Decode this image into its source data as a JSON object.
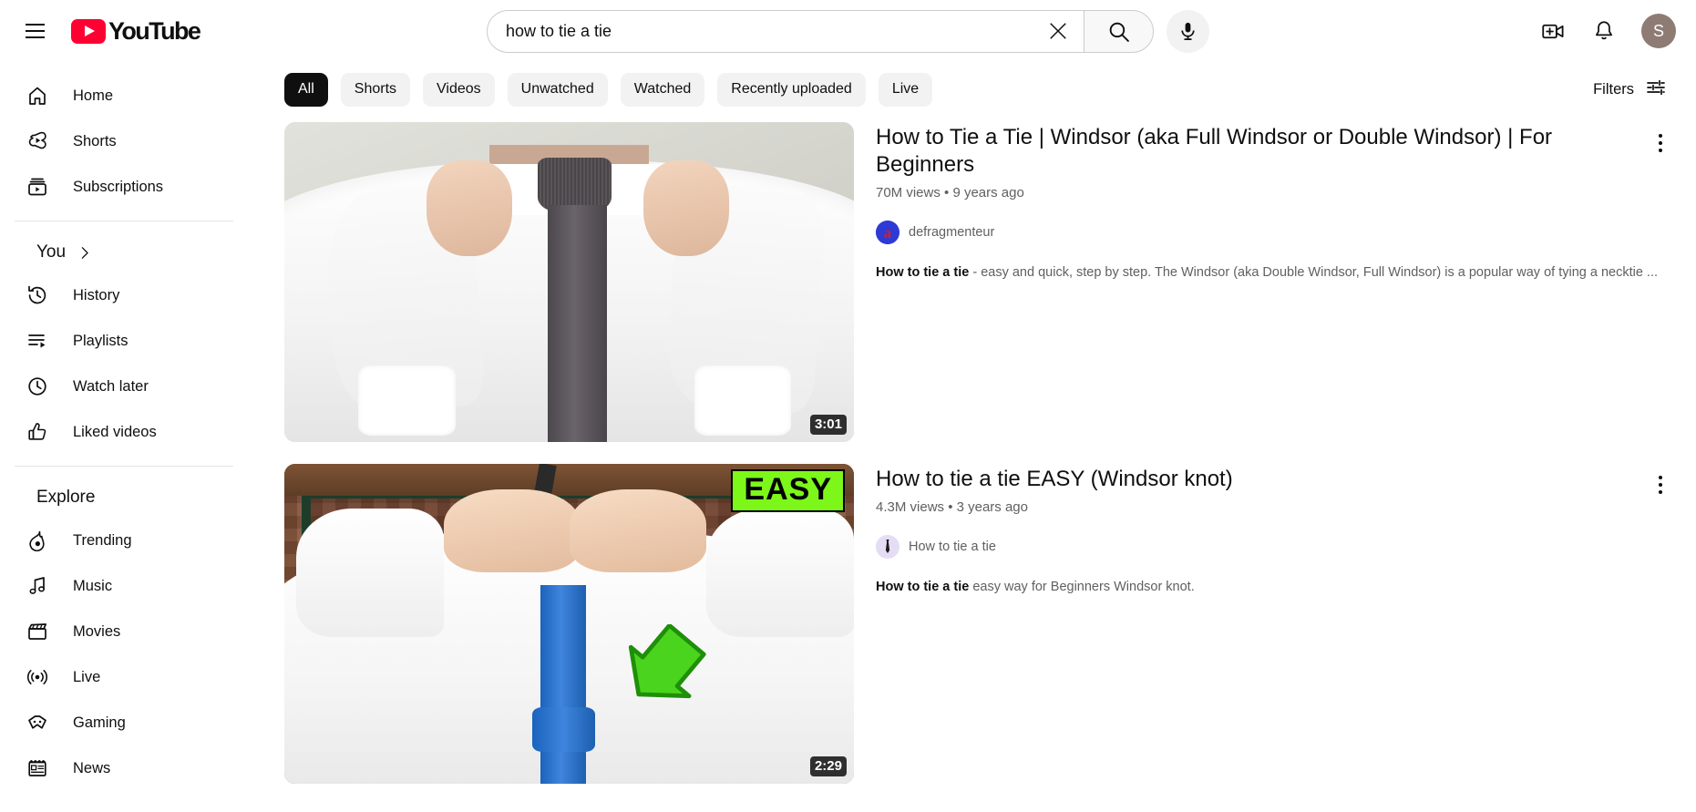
{
  "topbar": {
    "menu_icon": "hamburger-menu-icon",
    "logo_text": "YouTube",
    "search": {
      "value": "how to tie a tie",
      "placeholder": "Search",
      "clear_icon": "close-x-icon",
      "search_icon": "magnifier-icon",
      "mic_icon": "microphone-icon"
    },
    "create_icon": "create-video-icon",
    "notifications_icon": "bell-icon",
    "avatar_letter": "S",
    "avatar_color": "#8d7b74"
  },
  "sidebar": {
    "primary": [
      {
        "label": "Home",
        "icon": "home-icon"
      },
      {
        "label": "Shorts",
        "icon": "shorts-icon"
      },
      {
        "label": "Subscriptions",
        "icon": "subscriptions-icon"
      }
    ],
    "you_header": "You",
    "you_chevron_icon": "chevron-right-icon",
    "you_items": [
      {
        "label": "History",
        "icon": "history-icon"
      },
      {
        "label": "Playlists",
        "icon": "playlists-icon"
      },
      {
        "label": "Watch later",
        "icon": "clock-icon"
      },
      {
        "label": "Liked videos",
        "icon": "thumbs-up-icon"
      }
    ],
    "explore_header": "Explore",
    "explore_items": [
      {
        "label": "Trending",
        "icon": "trending-flame-icon"
      },
      {
        "label": "Music",
        "icon": "music-note-icon"
      },
      {
        "label": "Movies",
        "icon": "clapperboard-icon"
      },
      {
        "label": "Live",
        "icon": "live-broadcast-icon"
      },
      {
        "label": "Gaming",
        "icon": "gamepad-icon"
      },
      {
        "label": "News",
        "icon": "newspaper-icon"
      }
    ]
  },
  "chips": [
    {
      "label": "All",
      "active": true
    },
    {
      "label": "Shorts",
      "active": false
    },
    {
      "label": "Videos",
      "active": false
    },
    {
      "label": "Unwatched",
      "active": false
    },
    {
      "label": "Watched",
      "active": false
    },
    {
      "label": "Recently uploaded",
      "active": false
    },
    {
      "label": "Live",
      "active": false
    }
  ],
  "filters": {
    "label": "Filters",
    "icon": "tune-sliders-icon"
  },
  "results": [
    {
      "title": "How to Tie a Tie | Windsor (aka Full Windsor or Double Windsor) | For Beginners",
      "meta": "70M views • 9 years ago",
      "channel": "defragmenteur",
      "description_bold": "How to tie a tie",
      "description_rest": " - easy and quick, step by step. The Windsor (aka Double Windsor, Full Windsor) is a popular way of tying a necktie ...",
      "duration": "3:01",
      "menu_icon": "more-vertical-icon"
    },
    {
      "title": "How to tie a tie EASY (Windsor knot)",
      "meta": "4.3M views • 3 years ago",
      "channel": "How to tie a tie",
      "description_bold": "How to tie a tie",
      "description_rest": " easy way for Beginners Windsor knot.",
      "duration": "2:29",
      "thumbnail_badge": "EASY",
      "menu_icon": "more-vertical-icon"
    }
  ]
}
